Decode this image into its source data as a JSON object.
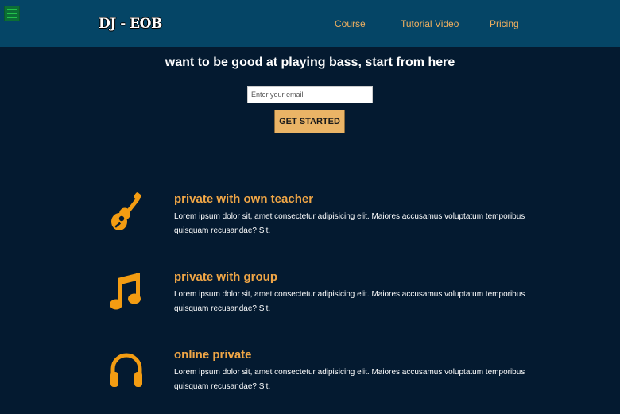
{
  "header": {
    "logo": "DJ - EOB",
    "nav": [
      {
        "label": "Course"
      },
      {
        "label": "Tutorial Video"
      },
      {
        "label": "Pricing"
      }
    ]
  },
  "hero": {
    "heading": "want to be good at playing bass, start from here",
    "email_placeholder": "Enter your email",
    "cta_label": "GET STARTED"
  },
  "features": [
    {
      "icon": "guitar-icon",
      "title": "private with own teacher",
      "description": "Lorem ipsum dolor sit, amet consectetur adipisicing elit. Maiores accusamus voluptatum temporibus quisquam recusandae? Sit."
    },
    {
      "icon": "music-note-icon",
      "title": "private with group",
      "description": "Lorem ipsum dolor sit, amet consectetur adipisicing elit. Maiores accusamus voluptatum temporibus quisquam recusandae? Sit."
    },
    {
      "icon": "headphones-icon",
      "title": "online private",
      "description": "Lorem ipsum dolor sit, amet consectetur adipisicing elit. Maiores accusamus voluptatum temporibus quisquam recusandae? Sit."
    }
  ],
  "colors": {
    "header_bg": "#054566",
    "page_bg": "#041a30",
    "accent": "#f0a646",
    "button_bg": "#eab466",
    "menu_toggle": "#0c6e35"
  }
}
